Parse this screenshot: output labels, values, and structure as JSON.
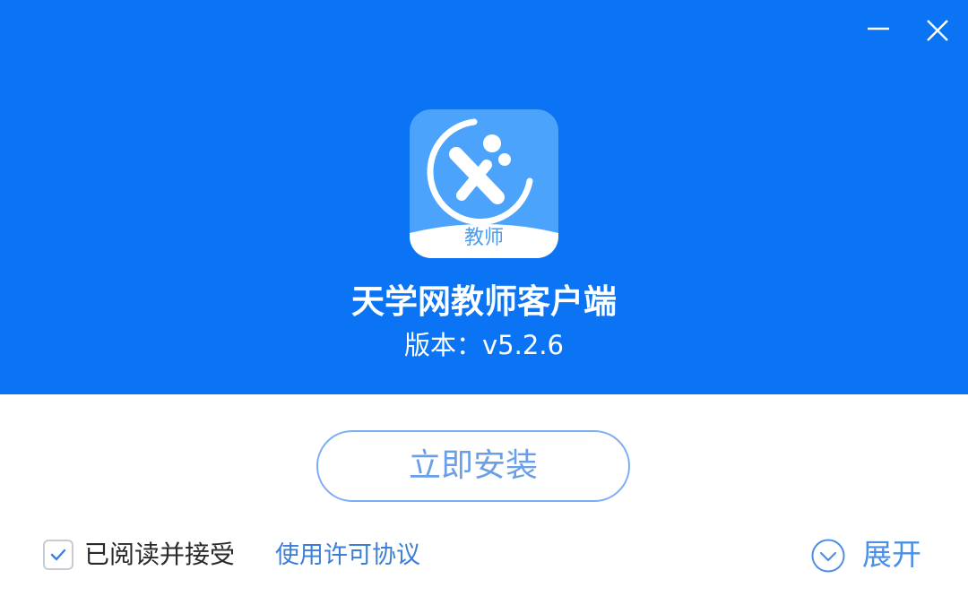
{
  "window": {
    "minimize_icon": "minimize-icon",
    "close_icon": "close-icon"
  },
  "header": {
    "background_color": "#0b74f4",
    "logo_label": "教师",
    "app_title": "天学网教师客户端",
    "version_text": "版本：v5.2.6"
  },
  "install": {
    "button_label": "立即安装",
    "border_color": "#7aaef4"
  },
  "agreement": {
    "checked": true,
    "label": "已阅读并接受",
    "link_text": "使用许可协议"
  },
  "expand": {
    "label": "展开",
    "icon": "chevron-down-circle-icon"
  }
}
